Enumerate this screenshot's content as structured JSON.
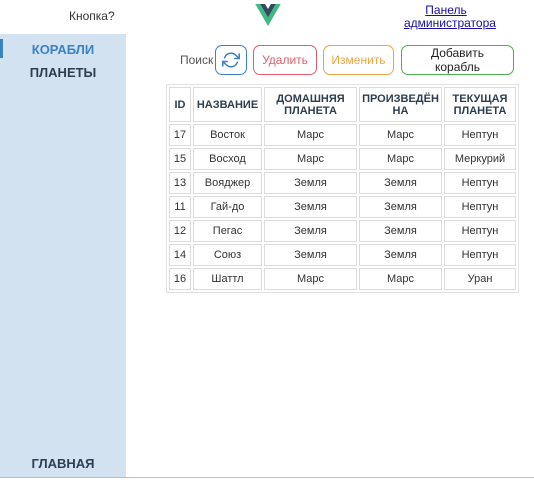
{
  "header": {
    "question": "Кнопка?",
    "admin_link": "Панель администратора"
  },
  "sidebar": {
    "items": [
      {
        "label": "КОРАБЛИ",
        "active": true
      },
      {
        "label": "ПЛАНЕТЫ",
        "active": false
      }
    ],
    "home": "ГЛАВНАЯ"
  },
  "toolbar": {
    "search_label": "Поиск",
    "refresh_icon": "refresh-icon",
    "delete_label": "Удалить",
    "edit_label": "Изменить",
    "add_label": "Добавить корабль"
  },
  "table": {
    "headers": [
      "ID",
      "НАЗВАНИЕ",
      "ДОМАШНЯЯ ПЛАНЕТА",
      "ПРОИЗВЕДЁН НА",
      "ТЕКУЩАЯ ПЛАНЕТА"
    ],
    "rows": [
      [
        "17",
        "Восток",
        "Марс",
        "Марс",
        "Нептун"
      ],
      [
        "15",
        "Восход",
        "Марс",
        "Марс",
        "Меркурий"
      ],
      [
        "13",
        "Вояджер",
        "Земля",
        "Земля",
        "Нептун"
      ],
      [
        "11",
        "Гай-до",
        "Земля",
        "Земля",
        "Нептун"
      ],
      [
        "12",
        "Пегас",
        "Земля",
        "Земля",
        "Нептун"
      ],
      [
        "14",
        "Союз",
        "Земля",
        "Земля",
        "Нептун"
      ],
      [
        "16",
        "Шаттл",
        "Марс",
        "Марс",
        "Уран"
      ]
    ]
  },
  "colors": {
    "sidebar_bg": "#d3e2f0",
    "accent": "#3b82c4",
    "danger": "#e35d6a",
    "warning": "#f0a445",
    "success": "#4caf50",
    "logo_green": "#41b883",
    "logo_dark": "#35495e"
  }
}
